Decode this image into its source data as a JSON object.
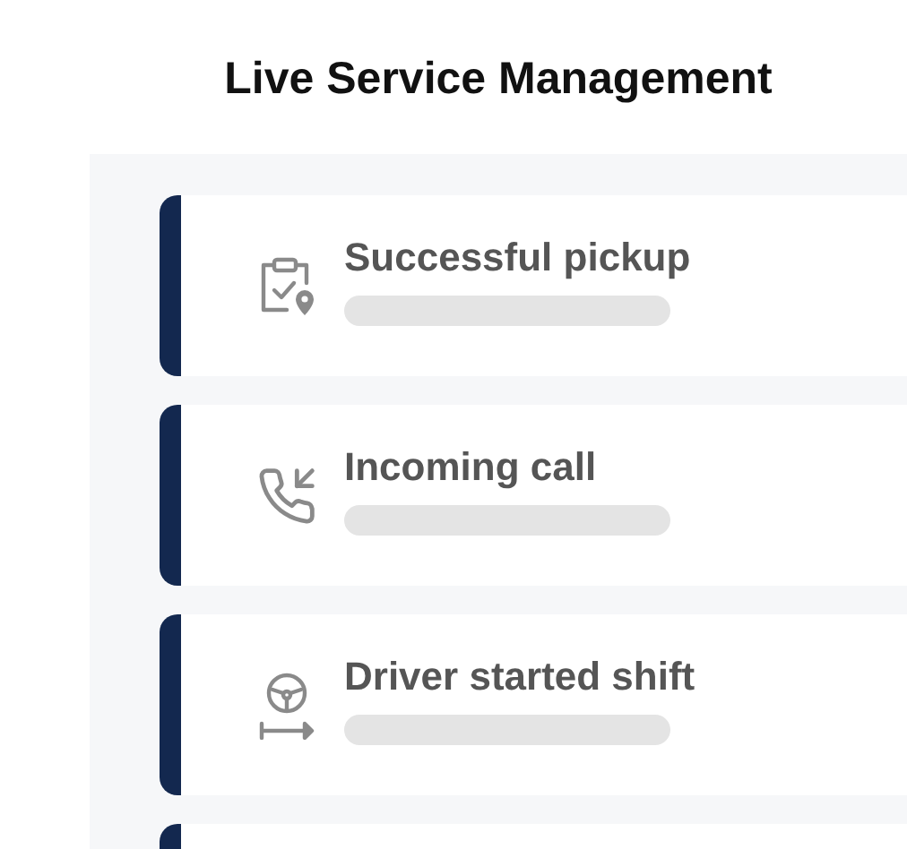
{
  "title": "Live Service Management",
  "events": [
    {
      "kind": "pickup",
      "title": "Successful pickup"
    },
    {
      "kind": "call",
      "title": "Incoming call"
    },
    {
      "kind": "shift",
      "title": "Driver started shift"
    },
    {
      "kind": "hidden"
    }
  ]
}
